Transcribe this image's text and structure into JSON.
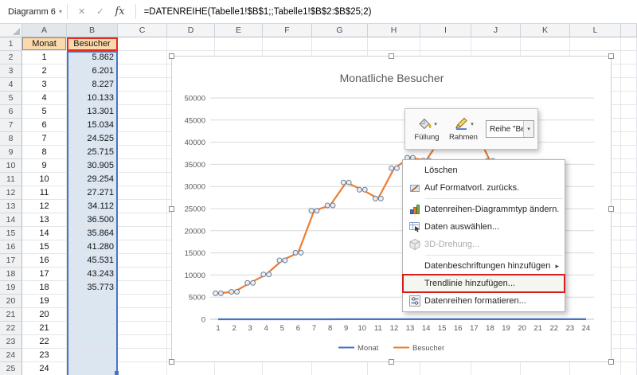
{
  "icons": {
    "cancel": "✕",
    "confirm": "✓",
    "insert_function": "fx",
    "dropdown": "▾",
    "submenu_arrow": "▸"
  },
  "formula_bar": {
    "name_box": "Diagramm 6",
    "formula": "=DATENREIHE(Tabelle1!$B$1;;Tabelle1!$B$2:$B$25;2)"
  },
  "grid": {
    "column_headers": [
      "A",
      "B",
      "C",
      "D",
      "E",
      "F",
      "G",
      "H",
      "I",
      "J",
      "K",
      "L"
    ],
    "highlighted_columns": [
      "A",
      "B"
    ],
    "rows": [
      {
        "n": "1",
        "a": "Monat",
        "b": "Besucher"
      },
      {
        "n": "2",
        "a": "1",
        "b": "5.862"
      },
      {
        "n": "3",
        "a": "2",
        "b": "6.201"
      },
      {
        "n": "4",
        "a": "3",
        "b": "8.227"
      },
      {
        "n": "5",
        "a": "4",
        "b": "10.133"
      },
      {
        "n": "6",
        "a": "5",
        "b": "13.301"
      },
      {
        "n": "7",
        "a": "6",
        "b": "15.034"
      },
      {
        "n": "8",
        "a": "7",
        "b": "24.525"
      },
      {
        "n": "9",
        "a": "8",
        "b": "25.715"
      },
      {
        "n": "10",
        "a": "9",
        "b": "30.905"
      },
      {
        "n": "11",
        "a": "10",
        "b": "29.254"
      },
      {
        "n": "12",
        "a": "11",
        "b": "27.271"
      },
      {
        "n": "13",
        "a": "12",
        "b": "34.112"
      },
      {
        "n": "14",
        "a": "13",
        "b": "36.500"
      },
      {
        "n": "15",
        "a": "14",
        "b": "35.864"
      },
      {
        "n": "16",
        "a": "15",
        "b": "41.280"
      },
      {
        "n": "17",
        "a": "16",
        "b": "45.531"
      },
      {
        "n": "18",
        "a": "17",
        "b": "43.243"
      },
      {
        "n": "19",
        "a": "18",
        "b": "35.773"
      },
      {
        "n": "20",
        "a": "19",
        "b": ""
      },
      {
        "n": "21",
        "a": "20",
        "b": ""
      },
      {
        "n": "22",
        "a": "21",
        "b": ""
      },
      {
        "n": "23",
        "a": "22",
        "b": ""
      },
      {
        "n": "24",
        "a": "23",
        "b": ""
      },
      {
        "n": "25",
        "a": "24",
        "b": ""
      }
    ]
  },
  "selection": {
    "series_name_range_color": "#e02b20",
    "values_range_color": "#4673c8",
    "values_fill": "#dce6f1",
    "header_fill": "#fbd9ab"
  },
  "mini_toolbar": {
    "fill_label": "Füllung",
    "border_label": "Rahmen",
    "selection_dropdown": "Reihe \"Besuch..."
  },
  "context_menu": {
    "annotation_color": "#d81e1e",
    "items": [
      {
        "id": "delete",
        "label": "Löschen",
        "enabled": true
      },
      {
        "id": "reset-to-match-style",
        "label": "Auf Formatvorl. zurücks.",
        "icon": "reset",
        "enabled": true,
        "separator_after": true
      },
      {
        "id": "change-series-chart-type",
        "label": "Datenreihen-Diagrammtyp ändern...",
        "icon": "chart_type",
        "enabled": true
      },
      {
        "id": "select-data",
        "label": "Daten auswählen...",
        "icon": "select_data",
        "enabled": true
      },
      {
        "id": "rotation-3d",
        "label": "3D-Drehung...",
        "icon": "rotate_3d",
        "enabled": false,
        "separator_after": true
      },
      {
        "id": "add-data-labels",
        "label": "Datenbeschriftungen hinzufügen",
        "enabled": true,
        "submenu": true
      },
      {
        "id": "add-trendline",
        "label": "Trendlinie hinzufügen...",
        "enabled": true,
        "highlighted": true
      },
      {
        "id": "format-data-series",
        "label": "Datenreihen formatieren...",
        "icon": "format_series",
        "enabled": true
      }
    ]
  },
  "chart_data": {
    "type": "line",
    "title": "Monatliche Besucher",
    "x": [
      1,
      2,
      3,
      4,
      5,
      6,
      7,
      8,
      9,
      10,
      11,
      12,
      13,
      14,
      15,
      16,
      17,
      18,
      19,
      20,
      21,
      22,
      23,
      24
    ],
    "series": [
      {
        "name": "Monat",
        "color": "#4472c4",
        "values": [
          1,
          2,
          3,
          4,
          5,
          6,
          7,
          8,
          9,
          10,
          11,
          12,
          13,
          14,
          15,
          16,
          17,
          18,
          19,
          20,
          21,
          22,
          23,
          24
        ]
      },
      {
        "name": "Besucher",
        "color": "#ed7d31",
        "values": [
          5862,
          6201,
          8227,
          10133,
          13301,
          15034,
          24525,
          25715,
          30905,
          29254,
          27271,
          34112,
          36500,
          35864,
          41280,
          45531,
          43243,
          35773
        ]
      }
    ],
    "ylim": [
      0,
      50000
    ],
    "ytick_step": 5000,
    "grid": true,
    "legend_position": "bottom"
  }
}
